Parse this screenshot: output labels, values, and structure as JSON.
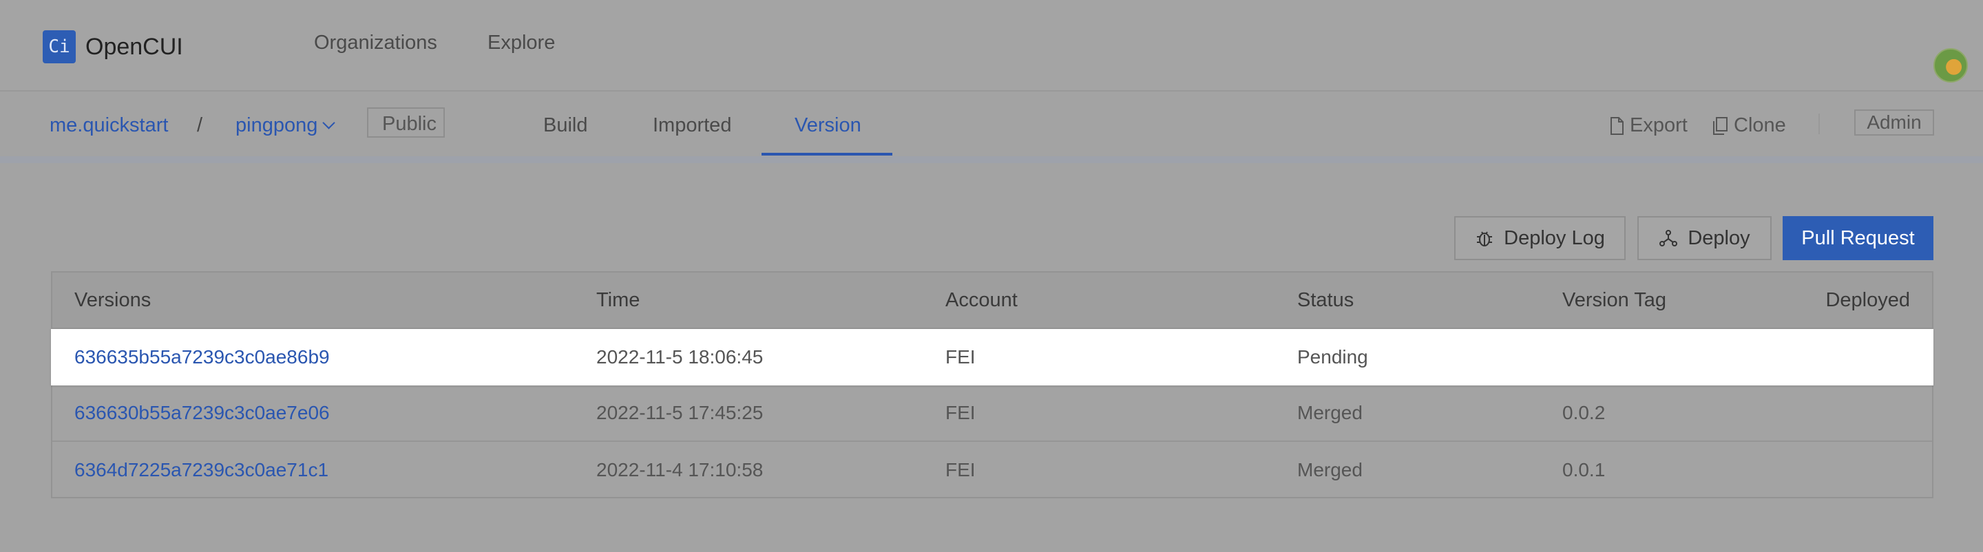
{
  "header": {
    "logo_icon": "Ci",
    "app_name": "OpenCUI",
    "nav": [
      "Organizations",
      "Explore"
    ]
  },
  "subheader": {
    "org": "me.quickstart",
    "separator": "/",
    "project": "pingpong",
    "visibility": "Public",
    "tabs": [
      "Build",
      "Imported",
      "Version"
    ],
    "active_tab": "Version",
    "actions": {
      "export": "Export",
      "clone": "Clone",
      "admin": "Admin"
    }
  },
  "toolbar": {
    "deploy_log": "Deploy Log",
    "deploy": "Deploy",
    "pull_request": "Pull Request"
  },
  "table": {
    "columns": [
      "Versions",
      "Time",
      "Account",
      "Status",
      "Version Tag",
      "Deployed"
    ],
    "rows": [
      {
        "version": "636635b55a7239c3c0ae86b9",
        "time": "2022-11-5 18:06:45",
        "account": "FEI",
        "status": "Pending",
        "tag": "",
        "deployed": ""
      },
      {
        "version": "636630b55a7239c3c0ae7e06",
        "time": "2022-11-5 17:45:25",
        "account": "FEI",
        "status": "Merged",
        "tag": "0.0.2",
        "deployed": ""
      },
      {
        "version": "6364d7225a7239c3c0ae71c1",
        "time": "2022-11-4 17:10:58",
        "account": "FEI",
        "status": "Merged",
        "tag": "0.0.1",
        "deployed": ""
      }
    ]
  },
  "colors": {
    "accent": "#2d5db4",
    "link": "#2a56b0",
    "overlay": "#a3a3a3"
  }
}
